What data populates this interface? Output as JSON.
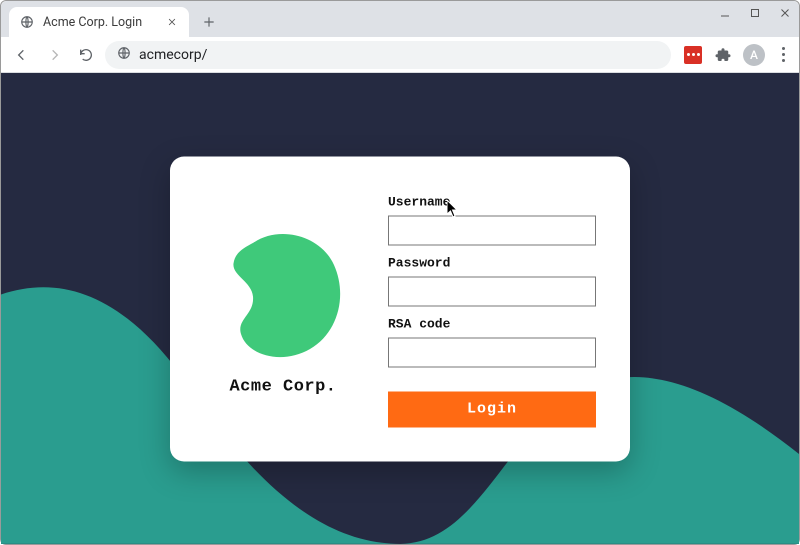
{
  "browser": {
    "tab_title": "Acme Corp. Login",
    "url": "acmecorp/",
    "avatar_initial": "A"
  },
  "page": {
    "brand_name": "Acme Corp.",
    "colors": {
      "bg_dark": "#252a41",
      "teal": "#2a9d8f",
      "blob": "#3fc97a",
      "accent": "#ff6a13"
    },
    "form": {
      "username_label": "Username",
      "username_value": "",
      "password_label": "Password",
      "password_value": "",
      "rsa_label": "RSA code",
      "rsa_value": "",
      "login_label": "Login"
    }
  }
}
